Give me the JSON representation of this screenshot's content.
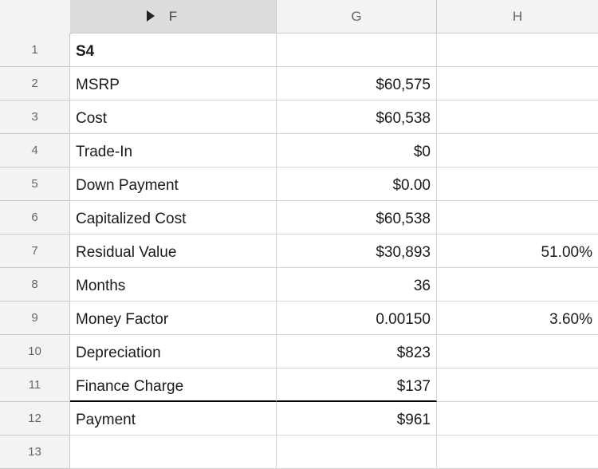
{
  "columns": [
    {
      "id": "F"
    },
    {
      "id": "G"
    },
    {
      "id": "H"
    }
  ],
  "rows": [
    {
      "num": "1",
      "f": "S4",
      "g": "",
      "h": ""
    },
    {
      "num": "2",
      "f": "MSRP",
      "g": "$60,575",
      "h": ""
    },
    {
      "num": "3",
      "f": "Cost",
      "g": "$60,538",
      "h": ""
    },
    {
      "num": "4",
      "f": "Trade-In",
      "g": "$0",
      "h": ""
    },
    {
      "num": "5",
      "f": "Down Payment",
      "g": "$0.00",
      "h": ""
    },
    {
      "num": "6",
      "f": "Capitalized Cost",
      "g": "$60,538",
      "h": ""
    },
    {
      "num": "7",
      "f": "Residual Value",
      "g": "$30,893",
      "h": "51.00%"
    },
    {
      "num": "8",
      "f": "Months",
      "g": "36",
      "h": ""
    },
    {
      "num": "9",
      "f": "Money Factor",
      "g": "0.00150",
      "h": "3.60%"
    },
    {
      "num": "10",
      "f": "Depreciation",
      "g": "$823",
      "h": ""
    },
    {
      "num": "11",
      "f": "Finance Charge",
      "g": "$137",
      "h": ""
    },
    {
      "num": "12",
      "f": "Payment",
      "g": "$961",
      "h": ""
    },
    {
      "num": "13",
      "f": "",
      "g": "",
      "h": ""
    }
  ],
  "icons": {
    "column_menu": "triangle-right-icon"
  },
  "colors": {
    "header_bg": "#f3f3f3",
    "selected_header_bg": "#dcdcdc",
    "grid": "#d4d4d4"
  }
}
